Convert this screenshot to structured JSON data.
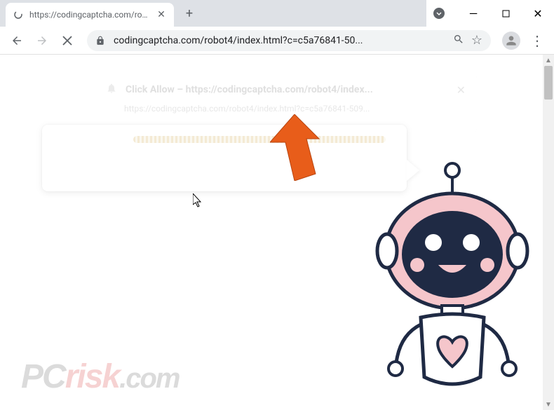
{
  "window": {
    "tab_title": "https://codingcaptcha.com/robot",
    "new_tab_label": "+",
    "minimize": "—",
    "maximize": "▢",
    "close": "✕"
  },
  "toolbar": {
    "back": "←",
    "forward": "→",
    "stop": "✕",
    "url": "codingcaptcha.com/robot4/index.html?c=c5a76841-50...",
    "star": "☆",
    "menu": "⋮"
  },
  "faded_popup": {
    "title": "Click Allow – https://codingcaptcha.com/robot4/index...",
    "url": "https://codingcaptcha.com/robot4/index.html?c=c5a76841-509...",
    "close": "✕"
  },
  "watermark": {
    "pc": "PC",
    "risk": "risk",
    "com": ".com"
  },
  "icons": {
    "tab_close": "✕"
  }
}
